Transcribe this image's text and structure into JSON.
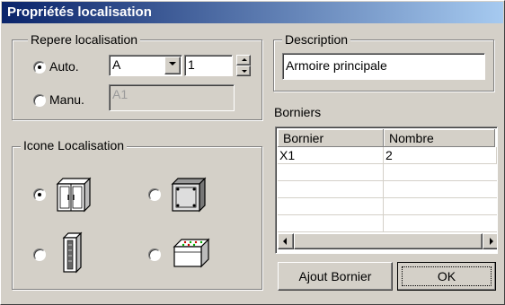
{
  "window": {
    "title": "Propriétés localisation"
  },
  "repere": {
    "legend": "Repere localisation",
    "auto_label": "Auto.",
    "manu_label": "Manu.",
    "auto_selected": true,
    "combo_value": "A",
    "number_value": "1",
    "manu_value": "A1"
  },
  "description": {
    "legend": "Description",
    "value": "Armoire principale"
  },
  "borniers": {
    "label": "Borniers",
    "columns": [
      "Bornier",
      "Nombre"
    ],
    "rows": [
      {
        "bornier": "X1",
        "nombre": "2"
      }
    ]
  },
  "icones": {
    "legend": "Icone Localisation",
    "items": [
      {
        "name": "double-cabinet-icon",
        "selected": true
      },
      {
        "name": "box-enclosure-icon",
        "selected": false
      },
      {
        "name": "column-cabinet-icon",
        "selected": false
      },
      {
        "name": "desk-console-icon",
        "selected": false
      }
    ]
  },
  "buttons": {
    "ajout_bornier": "Ajout Bornier",
    "ok": "OK"
  }
}
